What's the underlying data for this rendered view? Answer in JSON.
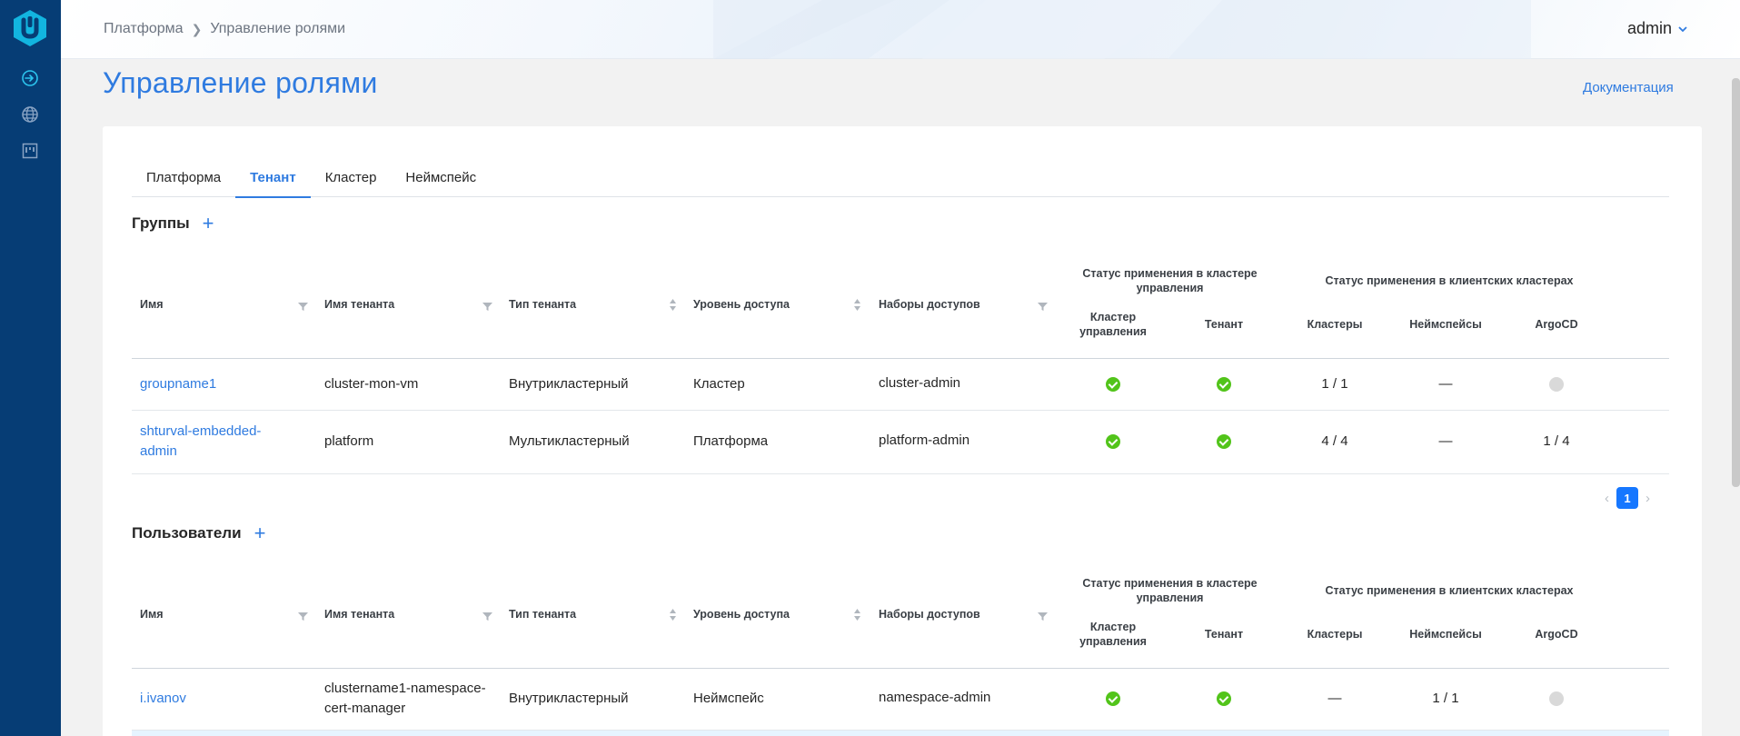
{
  "header": {
    "breadcrumb": [
      "Платформа",
      "Управление ролями"
    ],
    "user": "admin"
  },
  "page": {
    "title": "Управление ролями",
    "doc_link": "Документация"
  },
  "tabs": [
    "Платформа",
    "Тенант",
    "Кластер",
    "Неймспейс"
  ],
  "active_tab": "Тенант",
  "columns": {
    "name": "Имя",
    "tenant_name": "Имя тенанта",
    "tenant_type": "Тип тенанта",
    "access_level": "Уровень доступа",
    "access_sets": "Наборы доступов",
    "mgmt_group": "Статус применения в кластере управления",
    "client_group": "Статус применения в клиентских кластерах",
    "mgmt_cluster": "Кластер управления",
    "tenant": "Тенант",
    "clusters": "Кластеры",
    "namespaces": "Неймспейсы",
    "argocd": "ArgoCD"
  },
  "groups": {
    "title": "Группы",
    "add": "+",
    "rows": [
      {
        "name": "groupname1",
        "tenant_name": "cluster-mon-vm",
        "tenant_type": "Внутрикластерный",
        "access_level": "Кластер",
        "access_sets": "cluster-admin",
        "clusters": "1 / 1",
        "namespaces": "—",
        "argocd": ""
      },
      {
        "name": "shturval-embedded-admin",
        "tenant_name": "platform",
        "tenant_type": "Мультикластерный",
        "access_level": "Платформа",
        "access_sets": "platform-admin",
        "clusters": "4 / 4",
        "namespaces": "—",
        "argocd": "1 / 4"
      }
    ]
  },
  "pagination": {
    "current": "1"
  },
  "users": {
    "title": "Пользователи",
    "add": "+",
    "rows": [
      {
        "name": "i.ivanov",
        "tenant_name": "clustername1-namespace-cert-manager",
        "tenant_type": "Внутрикластерный",
        "access_level": "Неймспейс",
        "access_sets": "namespace-admin",
        "clusters": "—",
        "namespaces": "1 / 1",
        "argocd": ""
      }
    ]
  },
  "colors": {
    "accent": "#2f7be0",
    "sidebar": "#063d75",
    "success": "#52c41a",
    "logo": "#12b5e0"
  }
}
